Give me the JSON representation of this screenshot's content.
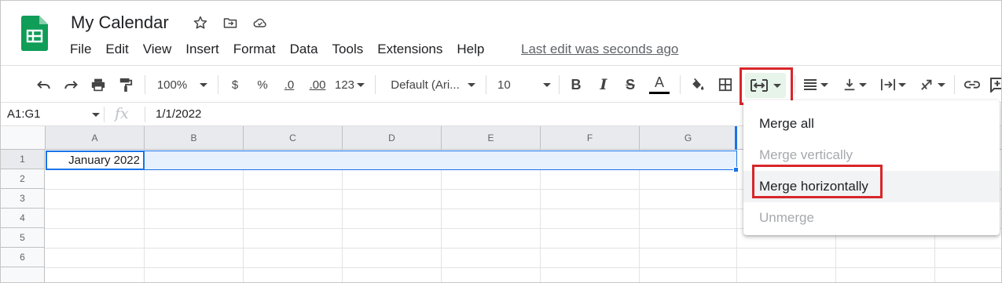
{
  "doc": {
    "title": "My Calendar"
  },
  "menubar": [
    "File",
    "Edit",
    "View",
    "Insert",
    "Format",
    "Data",
    "Tools",
    "Extensions",
    "Help"
  ],
  "last_edit": "Last edit was seconds ago",
  "toolbar": {
    "zoom": "100%",
    "currency": "$",
    "percent": "%",
    "dec_decrease": ".0",
    "dec_increase": ".00",
    "more_formats": "123",
    "font": "Default (Ari...",
    "font_size": "10",
    "bold": "B",
    "italic": "I",
    "strike": "S",
    "text_color": "A"
  },
  "formula_bar": {
    "name_box": "A1:G1",
    "fx": "fx",
    "value": "1/1/2022"
  },
  "columns": [
    "A",
    "B",
    "C",
    "D",
    "E",
    "F",
    "G"
  ],
  "rows": [
    "1",
    "2",
    "3",
    "4",
    "5",
    "6"
  ],
  "cells": {
    "A1": "January 2022"
  },
  "merge_menu": {
    "items": [
      "Merge all",
      "Merge vertically",
      "Merge horizontally",
      "Unmerge"
    ],
    "disabled": [
      "Merge vertically",
      "Unmerge"
    ],
    "highlighted": "Merge horizontally"
  },
  "colors": {
    "selection": "#1a73e8",
    "highlight_box": "#d7262a",
    "sheets_green": "#0f9d58"
  }
}
